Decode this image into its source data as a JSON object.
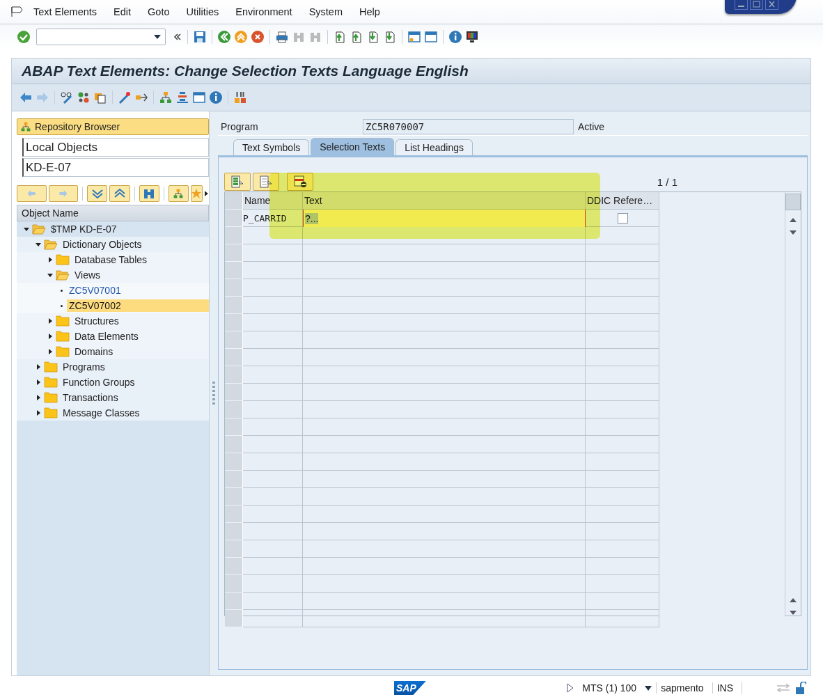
{
  "menu_bar": {
    "items": [
      "Text Elements",
      "Edit",
      "Goto",
      "Utilities",
      "Environment",
      "System",
      "Help"
    ]
  },
  "title": "ABAP Text Elements: Change Selection Texts Language English",
  "navigator": {
    "header": "Repository Browser",
    "object_type": "Local Objects",
    "package": "KD-E-07",
    "column": "Object Name",
    "tree": [
      {
        "label": "$TMP KD-E-07",
        "kind": "folder",
        "expanded": true,
        "selected": false,
        "children": [
          {
            "label": "Dictionary Objects",
            "kind": "folder",
            "expanded": true,
            "selected": false,
            "children": [
              {
                "label": "Database Tables",
                "kind": "folder",
                "expanded": false,
                "selected": false
              },
              {
                "label": "Views",
                "kind": "folder",
                "expanded": true,
                "selected": false,
                "children": [
                  {
                    "label": "ZC5V07001",
                    "kind": "object",
                    "selected": false
                  },
                  {
                    "label": "ZC5V07002",
                    "kind": "object",
                    "selected": true
                  }
                ]
              },
              {
                "label": "Structures",
                "kind": "folder",
                "expanded": false,
                "selected": false
              },
              {
                "label": "Data Elements",
                "kind": "folder",
                "expanded": false,
                "selected": false
              },
              {
                "label": "Domains",
                "kind": "folder",
                "expanded": false,
                "selected": false
              }
            ]
          },
          {
            "label": "Programs",
            "kind": "folder",
            "expanded": false,
            "selected": false
          },
          {
            "label": "Function Groups",
            "kind": "folder",
            "expanded": false,
            "selected": false
          },
          {
            "label": "Transactions",
            "kind": "folder",
            "expanded": false,
            "selected": false
          },
          {
            "label": "Message Classes",
            "kind": "folder",
            "expanded": false,
            "selected": false
          }
        ]
      }
    ]
  },
  "program": {
    "label": "Program",
    "value": "ZC5R070007",
    "status": "Active"
  },
  "tabs": [
    {
      "label": "Text Symbols",
      "selected": false
    },
    {
      "label": "Selection Texts",
      "selected": true
    },
    {
      "label": "List Headings",
      "selected": false
    }
  ],
  "page_counter": "1 / 1",
  "table": {
    "columns": [
      "Name",
      "Text",
      "DDIC Refere…"
    ],
    "rows": [
      {
        "name": "P_CARRID",
        "text": "?...",
        "ddic_reference": false
      }
    ]
  },
  "status_bar": {
    "logo": "SAP",
    "system": "MTS (1) 100",
    "user": "sapmento",
    "mode": "INS"
  }
}
